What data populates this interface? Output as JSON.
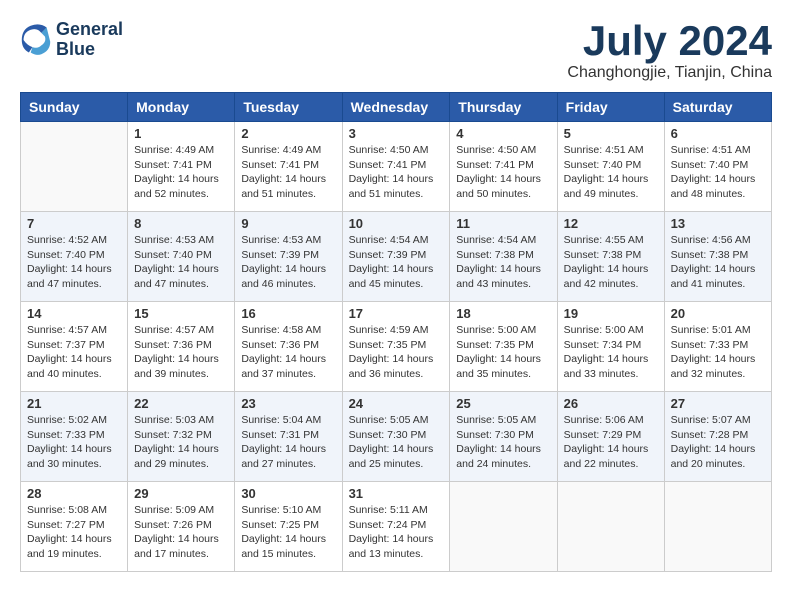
{
  "header": {
    "logo_line1": "General",
    "logo_line2": "Blue",
    "month_title": "July 2024",
    "location": "Changhongjie, Tianjin, China"
  },
  "days_of_week": [
    "Sunday",
    "Monday",
    "Tuesday",
    "Wednesday",
    "Thursday",
    "Friday",
    "Saturday"
  ],
  "weeks": [
    [
      {
        "day": "",
        "sunrise": "",
        "sunset": "",
        "daylight": ""
      },
      {
        "day": "1",
        "sunrise": "Sunrise: 4:49 AM",
        "sunset": "Sunset: 7:41 PM",
        "daylight": "Daylight: 14 hours and 52 minutes."
      },
      {
        "day": "2",
        "sunrise": "Sunrise: 4:49 AM",
        "sunset": "Sunset: 7:41 PM",
        "daylight": "Daylight: 14 hours and 51 minutes."
      },
      {
        "day": "3",
        "sunrise": "Sunrise: 4:50 AM",
        "sunset": "Sunset: 7:41 PM",
        "daylight": "Daylight: 14 hours and 51 minutes."
      },
      {
        "day": "4",
        "sunrise": "Sunrise: 4:50 AM",
        "sunset": "Sunset: 7:41 PM",
        "daylight": "Daylight: 14 hours and 50 minutes."
      },
      {
        "day": "5",
        "sunrise": "Sunrise: 4:51 AM",
        "sunset": "Sunset: 7:40 PM",
        "daylight": "Daylight: 14 hours and 49 minutes."
      },
      {
        "day": "6",
        "sunrise": "Sunrise: 4:51 AM",
        "sunset": "Sunset: 7:40 PM",
        "daylight": "Daylight: 14 hours and 48 minutes."
      }
    ],
    [
      {
        "day": "7",
        "sunrise": "Sunrise: 4:52 AM",
        "sunset": "Sunset: 7:40 PM",
        "daylight": "Daylight: 14 hours and 47 minutes."
      },
      {
        "day": "8",
        "sunrise": "Sunrise: 4:53 AM",
        "sunset": "Sunset: 7:40 PM",
        "daylight": "Daylight: 14 hours and 47 minutes."
      },
      {
        "day": "9",
        "sunrise": "Sunrise: 4:53 AM",
        "sunset": "Sunset: 7:39 PM",
        "daylight": "Daylight: 14 hours and 46 minutes."
      },
      {
        "day": "10",
        "sunrise": "Sunrise: 4:54 AM",
        "sunset": "Sunset: 7:39 PM",
        "daylight": "Daylight: 14 hours and 45 minutes."
      },
      {
        "day": "11",
        "sunrise": "Sunrise: 4:54 AM",
        "sunset": "Sunset: 7:38 PM",
        "daylight": "Daylight: 14 hours and 43 minutes."
      },
      {
        "day": "12",
        "sunrise": "Sunrise: 4:55 AM",
        "sunset": "Sunset: 7:38 PM",
        "daylight": "Daylight: 14 hours and 42 minutes."
      },
      {
        "day": "13",
        "sunrise": "Sunrise: 4:56 AM",
        "sunset": "Sunset: 7:38 PM",
        "daylight": "Daylight: 14 hours and 41 minutes."
      }
    ],
    [
      {
        "day": "14",
        "sunrise": "Sunrise: 4:57 AM",
        "sunset": "Sunset: 7:37 PM",
        "daylight": "Daylight: 14 hours and 40 minutes."
      },
      {
        "day": "15",
        "sunrise": "Sunrise: 4:57 AM",
        "sunset": "Sunset: 7:36 PM",
        "daylight": "Daylight: 14 hours and 39 minutes."
      },
      {
        "day": "16",
        "sunrise": "Sunrise: 4:58 AM",
        "sunset": "Sunset: 7:36 PM",
        "daylight": "Daylight: 14 hours and 37 minutes."
      },
      {
        "day": "17",
        "sunrise": "Sunrise: 4:59 AM",
        "sunset": "Sunset: 7:35 PM",
        "daylight": "Daylight: 14 hours and 36 minutes."
      },
      {
        "day": "18",
        "sunrise": "Sunrise: 5:00 AM",
        "sunset": "Sunset: 7:35 PM",
        "daylight": "Daylight: 14 hours and 35 minutes."
      },
      {
        "day": "19",
        "sunrise": "Sunrise: 5:00 AM",
        "sunset": "Sunset: 7:34 PM",
        "daylight": "Daylight: 14 hours and 33 minutes."
      },
      {
        "day": "20",
        "sunrise": "Sunrise: 5:01 AM",
        "sunset": "Sunset: 7:33 PM",
        "daylight": "Daylight: 14 hours and 32 minutes."
      }
    ],
    [
      {
        "day": "21",
        "sunrise": "Sunrise: 5:02 AM",
        "sunset": "Sunset: 7:33 PM",
        "daylight": "Daylight: 14 hours and 30 minutes."
      },
      {
        "day": "22",
        "sunrise": "Sunrise: 5:03 AM",
        "sunset": "Sunset: 7:32 PM",
        "daylight": "Daylight: 14 hours and 29 minutes."
      },
      {
        "day": "23",
        "sunrise": "Sunrise: 5:04 AM",
        "sunset": "Sunset: 7:31 PM",
        "daylight": "Daylight: 14 hours and 27 minutes."
      },
      {
        "day": "24",
        "sunrise": "Sunrise: 5:05 AM",
        "sunset": "Sunset: 7:30 PM",
        "daylight": "Daylight: 14 hours and 25 minutes."
      },
      {
        "day": "25",
        "sunrise": "Sunrise: 5:05 AM",
        "sunset": "Sunset: 7:30 PM",
        "daylight": "Daylight: 14 hours and 24 minutes."
      },
      {
        "day": "26",
        "sunrise": "Sunrise: 5:06 AM",
        "sunset": "Sunset: 7:29 PM",
        "daylight": "Daylight: 14 hours and 22 minutes."
      },
      {
        "day": "27",
        "sunrise": "Sunrise: 5:07 AM",
        "sunset": "Sunset: 7:28 PM",
        "daylight": "Daylight: 14 hours and 20 minutes."
      }
    ],
    [
      {
        "day": "28",
        "sunrise": "Sunrise: 5:08 AM",
        "sunset": "Sunset: 7:27 PM",
        "daylight": "Daylight: 14 hours and 19 minutes."
      },
      {
        "day": "29",
        "sunrise": "Sunrise: 5:09 AM",
        "sunset": "Sunset: 7:26 PM",
        "daylight": "Daylight: 14 hours and 17 minutes."
      },
      {
        "day": "30",
        "sunrise": "Sunrise: 5:10 AM",
        "sunset": "Sunset: 7:25 PM",
        "daylight": "Daylight: 14 hours and 15 minutes."
      },
      {
        "day": "31",
        "sunrise": "Sunrise: 5:11 AM",
        "sunset": "Sunset: 7:24 PM",
        "daylight": "Daylight: 14 hours and 13 minutes."
      },
      {
        "day": "",
        "sunrise": "",
        "sunset": "",
        "daylight": ""
      },
      {
        "day": "",
        "sunrise": "",
        "sunset": "",
        "daylight": ""
      },
      {
        "day": "",
        "sunrise": "",
        "sunset": "",
        "daylight": ""
      }
    ]
  ]
}
